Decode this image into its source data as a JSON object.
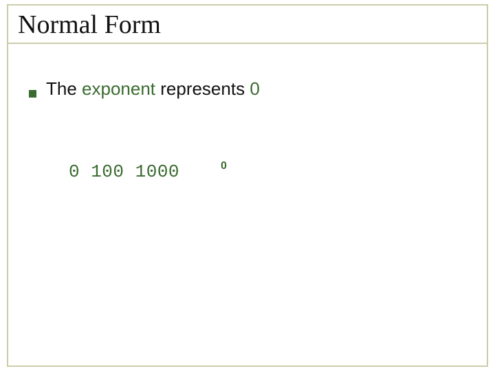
{
  "title": "Normal Form",
  "bullet": {
    "prefix": "The ",
    "exponent_word": "exponent",
    "middle": " represents ",
    "zero": "0"
  },
  "example": {
    "bits": "0 100 1000",
    "exp_value": "0"
  }
}
